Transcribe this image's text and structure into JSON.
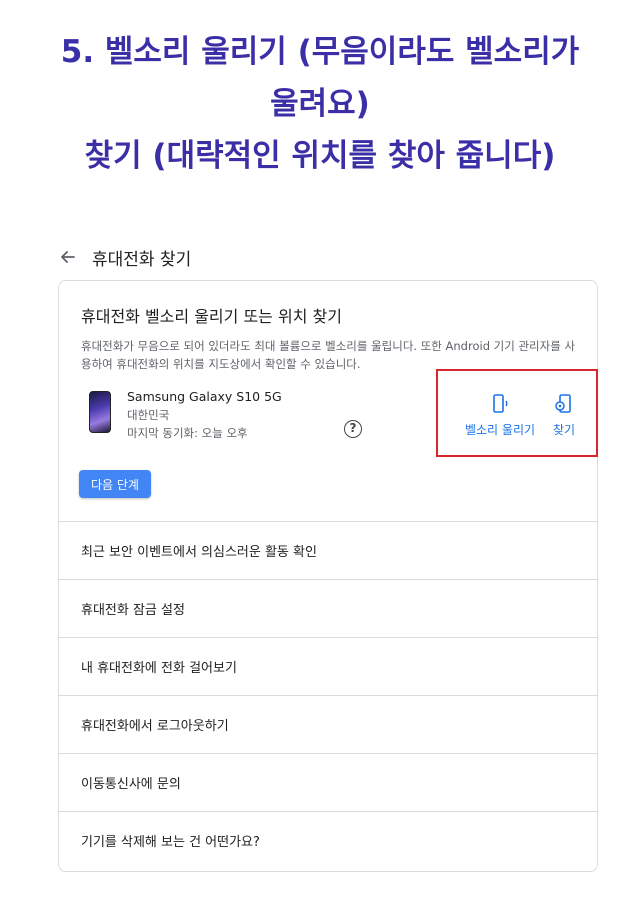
{
  "heading": {
    "line1": "5. 벨소리 울리기 (무음이라도 벨소리가",
    "line2": "울려요)",
    "line3": "찾기 (대략적인 위치를 찾아 줍니다)"
  },
  "topbar": {
    "title": "휴대전화 찾기",
    "back_icon": "arrow-left-icon"
  },
  "card": {
    "title": "휴대전화 벨소리 울리기 또는 위치 찾기",
    "description": "휴대전화가 무음으로 되어 있더라도 최대 볼륨으로 벨소리를 울립니다. 또한 Android 기기 관리자를 사용하여 휴대전화의 위치를 지도상에서 확인할 수 있습니다.",
    "device": {
      "name": "Samsung Galaxy S10 5G",
      "country": "대한민국",
      "last_sync": "마지막 동기화: 오늘 오후"
    },
    "help_icon_label": "?",
    "actions": {
      "ring_label": "벨소리 울리기",
      "find_label": "찾기"
    },
    "next_button": "다음 단계",
    "highlight_color": "#d8262f",
    "accent_color": "#1a73e8"
  },
  "list_items": [
    "최근 보안 이벤트에서 의심스러운 활동 확인",
    "휴대전화 잠금 설정",
    "내 휴대전화에 전화 걸어보기",
    "휴대전화에서 로그아웃하기",
    "이동통신사에 문의",
    "기기를 삭제해 보는 건 어떤가요?"
  ]
}
